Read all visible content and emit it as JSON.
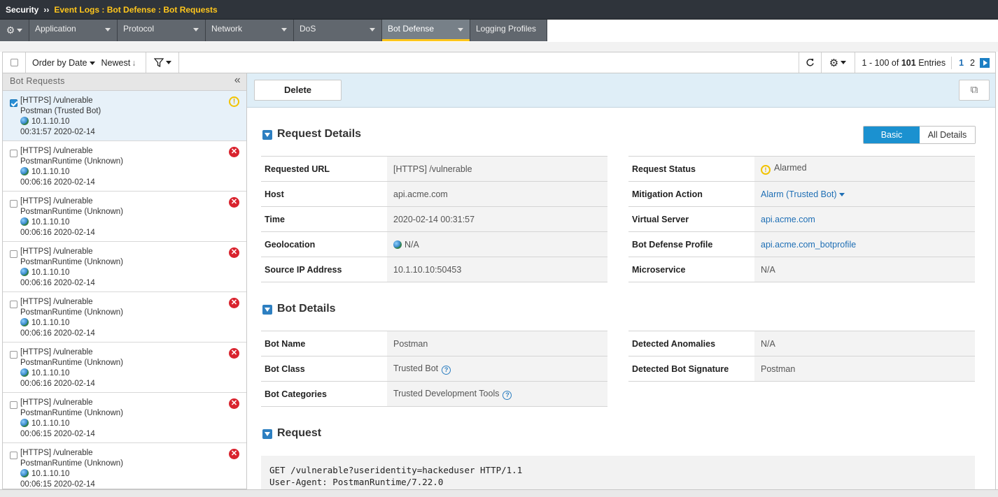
{
  "breadcrumb": {
    "root": "Security",
    "sep": "››",
    "path": "Event Logs : Bot Defense : Bot Requests"
  },
  "tabs": [
    {
      "label": "Application",
      "dropdown": true
    },
    {
      "label": "Protocol",
      "dropdown": true
    },
    {
      "label": "Network",
      "dropdown": true
    },
    {
      "label": "DoS",
      "dropdown": true
    },
    {
      "label": "Bot Defense",
      "dropdown": true,
      "active": true
    },
    {
      "label": "Logging Profiles",
      "dropdown": false
    }
  ],
  "toolbar": {
    "order_label": "Order by Date",
    "sort_label": "Newest",
    "sort_icon": "↓",
    "entries_range": "1 - 100 of",
    "entries_total": "101",
    "entries_suffix": "Entries",
    "page_current": "1",
    "page_next": "2"
  },
  "left_panel": {
    "title": "Bot Requests",
    "items": [
      {
        "url": "[HTTPS] /vulnerable",
        "client": "Postman (Trusted Bot)",
        "ip": "10.1.10.10",
        "time": "00:31:57 2020-02-14",
        "status": "warning",
        "selected": true
      },
      {
        "url": "[HTTPS] /vulnerable",
        "client": "PostmanRuntime (Unknown)",
        "ip": "10.1.10.10",
        "time": "00:06:16 2020-02-14",
        "status": "blocked"
      },
      {
        "url": "[HTTPS] /vulnerable",
        "client": "PostmanRuntime (Unknown)",
        "ip": "10.1.10.10",
        "time": "00:06:16 2020-02-14",
        "status": "blocked"
      },
      {
        "url": "[HTTPS] /vulnerable",
        "client": "PostmanRuntime (Unknown)",
        "ip": "10.1.10.10",
        "time": "00:06:16 2020-02-14",
        "status": "blocked"
      },
      {
        "url": "[HTTPS] /vulnerable",
        "client": "PostmanRuntime (Unknown)",
        "ip": "10.1.10.10",
        "time": "00:06:16 2020-02-14",
        "status": "blocked"
      },
      {
        "url": "[HTTPS] /vulnerable",
        "client": "PostmanRuntime (Unknown)",
        "ip": "10.1.10.10",
        "time": "00:06:16 2020-02-14",
        "status": "blocked"
      },
      {
        "url": "[HTTPS] /vulnerable",
        "client": "PostmanRuntime (Unknown)",
        "ip": "10.1.10.10",
        "time": "00:06:15 2020-02-14",
        "status": "blocked"
      },
      {
        "url": "[HTTPS] /vulnerable",
        "client": "PostmanRuntime (Unknown)",
        "ip": "10.1.10.10",
        "time": "00:06:15 2020-02-14",
        "status": "blocked"
      }
    ]
  },
  "actions": {
    "delete_label": "Delete"
  },
  "request_details": {
    "title": "Request Details",
    "view_basic": "Basic",
    "view_all": "All Details",
    "left": [
      {
        "key": "Requested URL",
        "value": "[HTTPS] /vulnerable"
      },
      {
        "key": "Host",
        "value": "api.acme.com"
      },
      {
        "key": "Time",
        "value": "2020-02-14 00:31:57"
      },
      {
        "key": "Geolocation",
        "value": "N/A"
      },
      {
        "key": "Source IP Address",
        "value": "10.1.10.10:50453"
      }
    ],
    "right": [
      {
        "key": "Request Status",
        "value": "Alarmed"
      },
      {
        "key": "Mitigation Action",
        "value": "Alarm (Trusted Bot)"
      },
      {
        "key": "Virtual Server",
        "value": "api.acme.com"
      },
      {
        "key": "Bot Defense Profile",
        "value": "api.acme.com_botprofile"
      },
      {
        "key": "Microservice",
        "value": "N/A"
      }
    ]
  },
  "bot_details": {
    "title": "Bot Details",
    "left": [
      {
        "key": "Bot Name",
        "value": "Postman"
      },
      {
        "key": "Bot Class",
        "value": "Trusted Bot"
      },
      {
        "key": "Bot Categories",
        "value": "Trusted Development Tools"
      }
    ],
    "right": [
      {
        "key": "Detected Anomalies",
        "value": "N/A"
      },
      {
        "key": "Detected Bot Signature",
        "value": "Postman"
      }
    ]
  },
  "request": {
    "title": "Request",
    "lines": [
      "GET /vulnerable?useridentity=hackeduser HTTP/1.1",
      "User-Agent: PostmanRuntime/7.22.0"
    ]
  },
  "colors": {
    "accent": "#ffc61c",
    "primary": "#1b91d0",
    "link": "#1f6fb5",
    "error": "#d9232e",
    "warning": "#f2c300"
  }
}
